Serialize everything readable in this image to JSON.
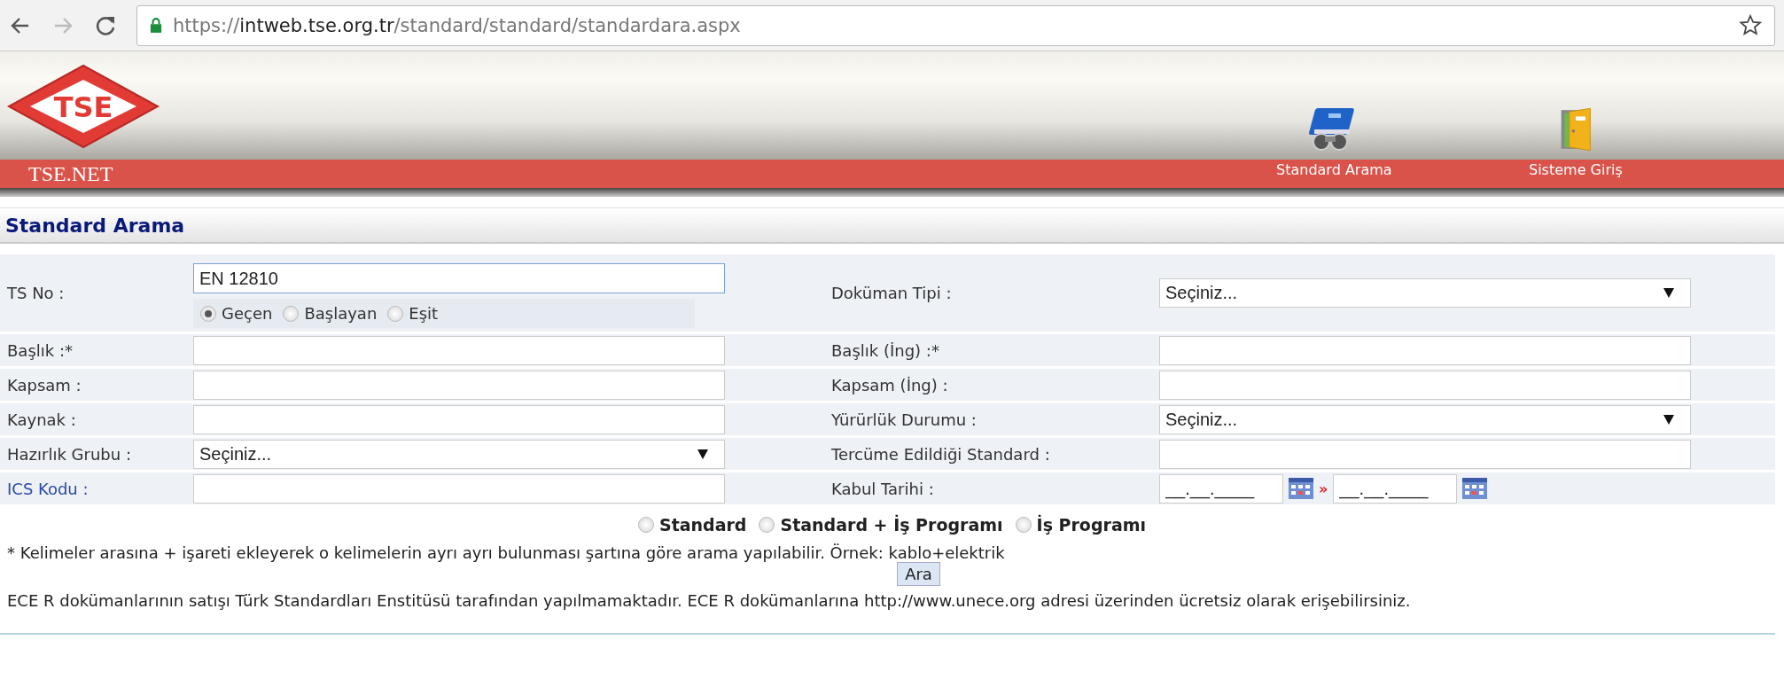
{
  "browser": {
    "url_scheme": "https://",
    "url_host": "intweb.tse.org.tr",
    "url_path": "/standard/standard/standardara.aspx",
    "bookmarked": false
  },
  "header": {
    "logo_text": "TSE",
    "site_name": "TSE.NET",
    "nav": [
      {
        "label": "Standard Arama"
      },
      {
        "label": "Sisteme Giriş"
      }
    ]
  },
  "section_title": "Standard Arama",
  "form": {
    "rows": [
      {
        "left": {
          "label": "TS No :",
          "kind": "text_radios",
          "value": "EN 12810",
          "options": [
            {
              "label": "Geçen",
              "selected": true
            },
            {
              "label": "Başlayan",
              "selected": false
            },
            {
              "label": "Eşit",
              "selected": false
            }
          ]
        },
        "right": {
          "label": "Doküman Tipi :",
          "kind": "select",
          "value": "Seçiniz..."
        }
      },
      {
        "left": {
          "label": "Başlık :*",
          "kind": "text"
        },
        "right": {
          "label": "Başlık (İng) :*",
          "kind": "text"
        }
      },
      {
        "left": {
          "label": "Kapsam :",
          "kind": "text"
        },
        "right": {
          "label": "Kapsam (İng) :",
          "kind": "text"
        }
      },
      {
        "left": {
          "label": "Kaynak :",
          "kind": "text"
        },
        "right": {
          "label": "Yürürlük Durumu :",
          "kind": "select",
          "value": "Seçiniz..."
        }
      },
      {
        "left": {
          "label": "Hazırlık Grubu :",
          "kind": "select",
          "value": "Seçiniz..."
        },
        "right": {
          "label": "Tercüme Edildiği Standard :",
          "kind": "text"
        }
      },
      {
        "left": {
          "label": "ICS Kodu :",
          "kind": "text",
          "link": true
        },
        "right": {
          "label": "Kabul Tarihi :",
          "kind": "date_range",
          "from": "__.__.____",
          "separator": "»",
          "to": "__.__.____"
        }
      }
    ]
  },
  "scope": [
    {
      "label": "Standard",
      "selected": false
    },
    {
      "label": "Standard + İş Programı",
      "selected": false
    },
    {
      "label": "İş Programı",
      "selected": false
    }
  ],
  "hint": "* Kelimeler arasına + işareti ekleyerek o kelimelerin ayrı ayrı bulunması şartına göre arama yapılabilir. Örnek: kablo+elektrik",
  "search_button": "Ara",
  "notice": "ECE R dokümanlarının satışı Türk Standardları Enstitüsü tarafından yapılmamaktadır. ECE R dokümanlarına http://www.unece.org adresi üzerinden ücretsiz olarak erişebilirsiniz."
}
